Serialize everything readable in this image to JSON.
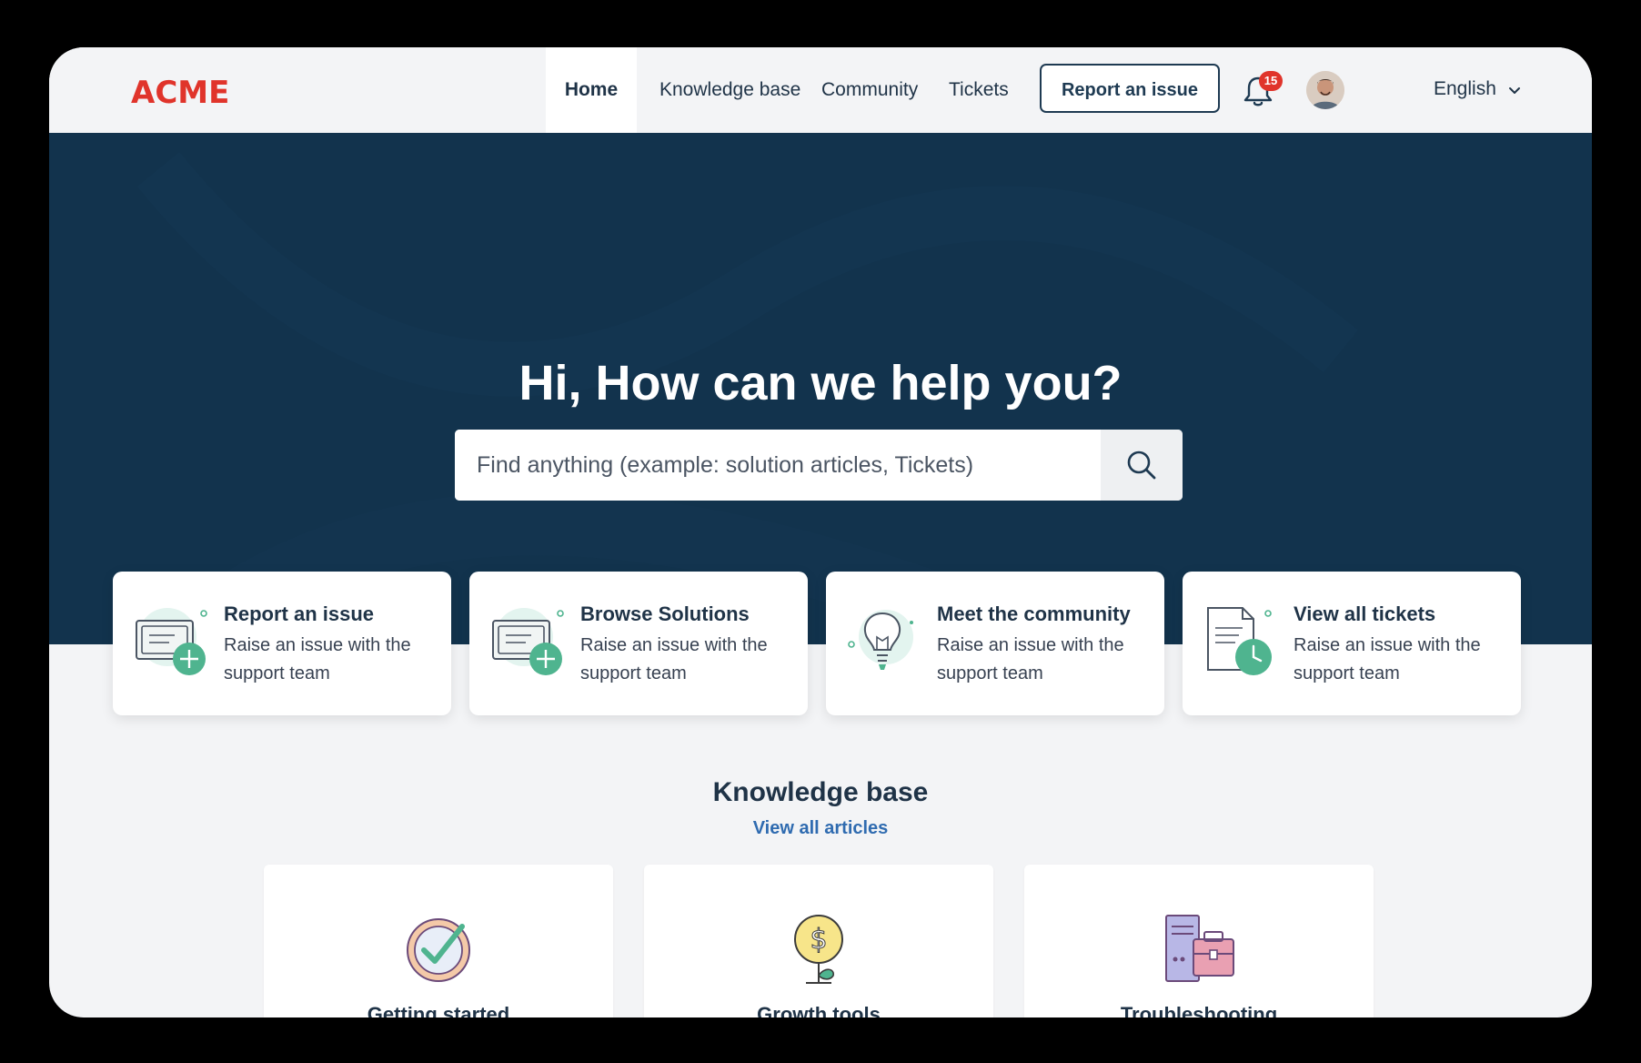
{
  "brand": {
    "logo_text": "ACME",
    "logo_color": "#e0342b"
  },
  "nav": {
    "items": [
      {
        "label": "Home",
        "active": true
      },
      {
        "label": "Knowledge base",
        "active": false
      },
      {
        "label": "Community",
        "active": false
      },
      {
        "label": "Tickets",
        "active": false
      }
    ],
    "report_button": "Report an issue",
    "notifications_count": "15",
    "language": "English"
  },
  "hero": {
    "title": "Hi, How can we help you?",
    "search_placeholder": "Find anything (example: solution articles, Tickets)",
    "background_color": "#12334d"
  },
  "quick_cards": [
    {
      "icon": "ticket-add-icon",
      "title": "Report an issue",
      "desc": "Raise an issue with the support team"
    },
    {
      "icon": "ticket-add-icon",
      "title": "Browse Solutions",
      "desc": "Raise an issue with the support team"
    },
    {
      "icon": "lightbulb-icon",
      "title": "Meet the community",
      "desc": "Raise an issue with the support team"
    },
    {
      "icon": "document-clock-icon",
      "title": "View all tickets",
      "desc": "Raise an issue with the support team"
    }
  ],
  "knowledge_base": {
    "title": "Knowledge base",
    "link": "View all articles",
    "categories": [
      {
        "icon": "clock-check-icon",
        "label": "Getting started"
      },
      {
        "icon": "dollar-plant-icon",
        "label": "Growth tools"
      },
      {
        "icon": "server-briefcase-icon",
        "label": "Troubleshooting"
      }
    ]
  }
}
